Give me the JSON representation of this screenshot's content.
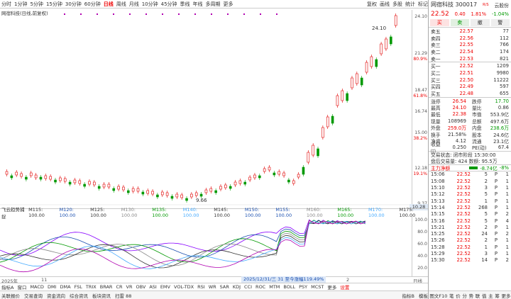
{
  "topbar": {
    "intervals": [
      "分时",
      "1分钟",
      "5分钟",
      "15分钟",
      "30分钟",
      "60分钟",
      "日线",
      "周线",
      "月线",
      "10分钟",
      "45分钟",
      "季线",
      "年线",
      "多周期",
      "更多"
    ],
    "active_interval": "日线",
    "tools": [
      "复权",
      "画线",
      "多股",
      "统计",
      "标记"
    ]
  },
  "chart": {
    "subtitle": "网宿科技(日线,前复权)",
    "price_ticks": [
      "24.10",
      "21.29",
      "80.9%",
      "18.47",
      "61.8%",
      "16.74",
      "15.00",
      "38.2%",
      "12.18",
      "19.1%",
      "9.37"
    ],
    "high_label": "24.10",
    "low_label": "9.66",
    "vol_tag": "10.28",
    "colors": {
      "up": "#e00000",
      "down": "#009900",
      "accent": "#e00000"
    }
  },
  "indicator": {
    "name": "飞云趋势捕捉",
    "params": [
      "M115: 100.00",
      "M120: 100.00",
      "M125: 100.00",
      "M130: 100.00",
      "M135: 100.00",
      "M140: 100.00",
      "M145: 100.00",
      "M150: 100.00",
      "M155: 100.00",
      "M160: 100.00",
      "M165: 100.00",
      "M170: 100.00",
      "M175: 100.00"
    ],
    "ticks": [
      "100.0",
      "80.0",
      "60.0",
      "40.0",
      "20.0"
    ]
  },
  "time_axis": {
    "left": "2025年",
    "mid": "11",
    "right": "2",
    "end": "日线"
  },
  "banner": "2025/12/31/三 31 至今涨幅119.49%",
  "tabs1": [
    "指标A",
    "窗口",
    "MACD",
    "DMI",
    "DMA",
    "FSL",
    "TRIX",
    "BRAR",
    "CR",
    "VR",
    "OBV",
    "ASI",
    "EMV",
    "VOL-TDX",
    "RSI",
    "WR",
    "SAR",
    "KDJ",
    "CCI",
    "ROC",
    "MTM",
    "BOLL",
    "PSY",
    "MCST",
    "更多",
    "设置"
  ],
  "tabs1_active": "设置",
  "tabs2": [
    "关联报价",
    "交易查询",
    "资金流向",
    "综合资讯",
    "板块资讯",
    "扫雷 88"
  ],
  "tabs2_right": [
    "指标B",
    "模板"
  ],
  "right": {
    "name": "网宿科技 300017",
    "badge": "R/S",
    "cloud": "云股份",
    "price": "22.52",
    "change": "0.40",
    "pct": "1.81%",
    "side_pct": "-1.04%",
    "buttons": [
      "买",
      "卖",
      "撤",
      "警"
    ],
    "asks": [
      {
        "l": "卖五",
        "p": "22.57",
        "v": "77"
      },
      {
        "l": "卖四",
        "p": "22.56",
        "v": "112"
      },
      {
        "l": "卖三",
        "p": "22.55",
        "v": "766"
      },
      {
        "l": "卖二",
        "p": "22.54",
        "v": "174"
      },
      {
        "l": "卖一",
        "p": "22.53",
        "v": "821"
      }
    ],
    "bids": [
      {
        "l": "买一",
        "p": "22.52",
        "v": "1209"
      },
      {
        "l": "买二",
        "p": "22.51",
        "v": "9980"
      },
      {
        "l": "买三",
        "p": "22.50",
        "v": "11222"
      },
      {
        "l": "买四",
        "p": "22.49",
        "v": "597"
      },
      {
        "l": "买五",
        "p": "22.48",
        "v": "655"
      }
    ],
    "stats": [
      {
        "k": "涨停",
        "v": "26.54",
        "k2": "跌停",
        "v2": "17.70"
      },
      {
        "k": "最高",
        "v": "24.10",
        "k2": "量比",
        "v2": "0.86"
      },
      {
        "k": "最低",
        "v": "22.38",
        "k2": "市值",
        "v2": "553.9亿"
      },
      {
        "k": "现量",
        "v": "108969",
        "k2": "总额",
        "v2": "497.6万"
      },
      {
        "k": "外盘",
        "v": "259.0万",
        "k2": "内盘",
        "v2": "238.6万"
      },
      {
        "k": "换手",
        "v": "21.58%",
        "k2": "股本",
        "v2": "24.6亿"
      },
      {
        "k": "净资",
        "v": "4.12",
        "k2": "流通",
        "v2": "23.1亿"
      },
      {
        "k": "收益㈢",
        "v": "0.250",
        "k2": "PE(动)",
        "v2": "67.4"
      }
    ],
    "trade_status": "交易状态: 闭市阶段 15:30:00",
    "after_hours": "盘后交易量: 424  数额: 95.5万",
    "main_flow_label": "主力净额",
    "main_flow_value": "-8.74亿",
    "main_flow_pct": "-8%",
    "ticks": [
      {
        "t": "15:06",
        "p": "22.52",
        "v": "5",
        "s": "P",
        "n": "1"
      },
      {
        "t": "15:08",
        "p": "22.52",
        "v": "2",
        "s": "P",
        "n": "1"
      },
      {
        "t": "15:10",
        "p": "22.52",
        "v": "3",
        "s": "P",
        "n": "1"
      },
      {
        "t": "15:12",
        "p": "22.52",
        "v": "5",
        "s": "P",
        "n": "1"
      },
      {
        "t": "15:13",
        "p": "22.52",
        "v": "1",
        "s": "P",
        "n": "1"
      },
      {
        "t": "15:14",
        "p": "22.52",
        "v": "268",
        "s": "P",
        "n": "1"
      },
      {
        "t": "15:15",
        "p": "22.52",
        "v": "5",
        "s": "P",
        "n": "2"
      },
      {
        "t": "15:16",
        "p": "22.52",
        "v": "5",
        "s": "P",
        "n": "4"
      },
      {
        "t": "15:21",
        "p": "22.52",
        "v": "2",
        "s": "P",
        "n": "1"
      },
      {
        "t": "15:25",
        "p": "22.52",
        "v": "24",
        "s": "P",
        "n": "2"
      },
      {
        "t": "15:26",
        "p": "22.52",
        "v": "2",
        "s": "P",
        "n": "1"
      },
      {
        "t": "15:28",
        "p": "22.52",
        "v": "1",
        "s": "P",
        "n": "1"
      },
      {
        "t": "15:29",
        "p": "22.52",
        "v": "3",
        "s": "P",
        "n": "1"
      },
      {
        "t": "15:30",
        "p": "22.52",
        "v": "14",
        "s": "P",
        "n": "2"
      }
    ],
    "bottom_tabs": [
      "图文F10",
      "笔",
      "价",
      "分",
      "势",
      "联",
      "值",
      "主",
      "筹",
      "更多"
    ]
  }
}
